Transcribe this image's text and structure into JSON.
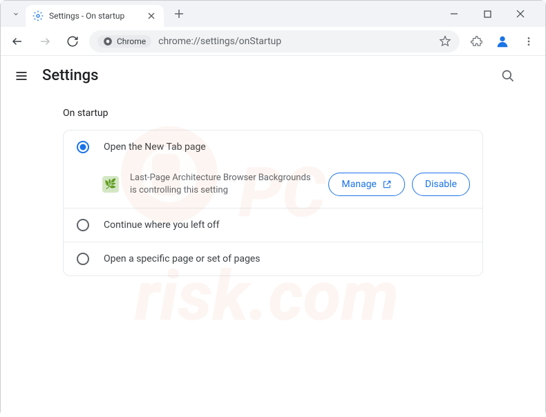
{
  "titlebar": {
    "tab_title": "Settings - On startup"
  },
  "toolbar": {
    "chrome_label": "Chrome",
    "url": "chrome://settings/onStartup"
  },
  "header": {
    "title": "Settings"
  },
  "section": {
    "title": "On startup",
    "options": [
      {
        "label": "Open the New Tab page",
        "selected": true
      },
      {
        "label": "Continue where you left off",
        "selected": false
      },
      {
        "label": "Open a specific page or set of pages",
        "selected": false
      }
    ],
    "extension": {
      "message": "Last-Page Architecture Browser Backgrounds is controlling this setting",
      "manage_label": "Manage",
      "disable_label": "Disable"
    }
  }
}
